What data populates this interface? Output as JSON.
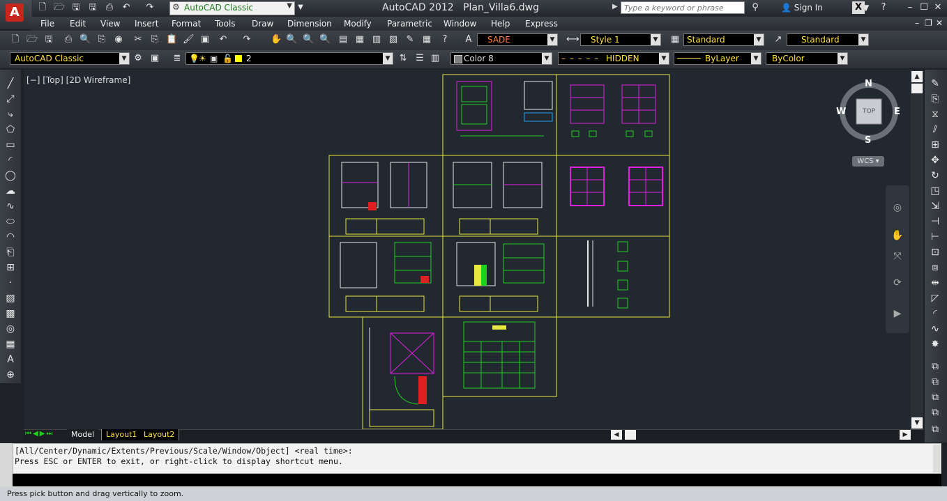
{
  "titlebar": {
    "app_title": "AutoCAD 2012",
    "file_name": "Plan_Villa6.dwg",
    "workspace": "AutoCAD Classic",
    "search_placeholder": "Type a keyword or phrase",
    "sign_in": "Sign In",
    "help_glyph": "?"
  },
  "menu": [
    "File",
    "Edit",
    "View",
    "Insert",
    "Format",
    "Tools",
    "Draw",
    "Dimension",
    "Modify",
    "Parametric",
    "Window",
    "Help",
    "Express"
  ],
  "toolbar1": {
    "text_style": "SADE",
    "dim_style": "Style 1",
    "table_style": "Standard",
    "mleader_style": "Standard"
  },
  "toolbar2": {
    "workspace": "AutoCAD Classic",
    "layer": "2",
    "color": "Color 8",
    "linetype": "HIDDEN",
    "lineweight": "ByLayer",
    "plotstyle": "ByColor"
  },
  "viewport_label": "[−] [Top] [2D Wireframe]",
  "viewcube": {
    "north": "N",
    "south": "S",
    "east": "E",
    "west": "W",
    "face": "TOP",
    "ucs": "WCS"
  },
  "tabs": {
    "model": "Model",
    "layout1": "Layout1",
    "layout2": "Layout2"
  },
  "command": {
    "line1": "[All/Center/Dynamic/Extents/Previous/Scale/Window/Object] <real time>:",
    "line2": "Press ESC or ENTER to exit, or right-click to display shortcut menu."
  },
  "status_text": "Press pick button and drag vertically to zoom.",
  "colors": {
    "sheet_border": "#e8e840",
    "accent_red": "#c8251c",
    "magenta": "#e020e0",
    "green": "#20d020",
    "yellow": "#e8e840"
  }
}
